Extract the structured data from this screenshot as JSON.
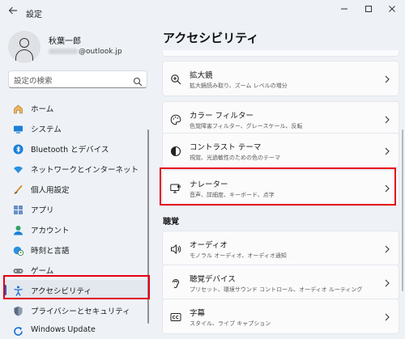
{
  "window": {
    "title": "設定",
    "back_icon": "back-arrow-icon",
    "controls": [
      "minimize-icon",
      "maximize-icon",
      "close-icon"
    ]
  },
  "user": {
    "name": "秋葉一郎",
    "email_visible": "@outlook.jp"
  },
  "search": {
    "placeholder": "設定の検索"
  },
  "sidebar": {
    "items": [
      {
        "label": "ホーム",
        "icon": "home-icon"
      },
      {
        "label": "システム",
        "icon": "system-icon"
      },
      {
        "label": "Bluetooth とデバイス",
        "icon": "bluetooth-icon"
      },
      {
        "label": "ネットワークとインターネット",
        "icon": "wifi-icon"
      },
      {
        "label": "個人用設定",
        "icon": "brush-icon"
      },
      {
        "label": "アプリ",
        "icon": "apps-icon"
      },
      {
        "label": "アカウント",
        "icon": "account-icon"
      },
      {
        "label": "時刻と言語",
        "icon": "globe-clock-icon"
      },
      {
        "label": "ゲーム",
        "icon": "gamepad-icon"
      },
      {
        "label": "アクセシビリティ",
        "icon": "accessibility-icon",
        "selected": true
      },
      {
        "label": "プライバシーとセキュリティ",
        "icon": "shield-icon"
      },
      {
        "label": "Windows Update",
        "icon": "update-icon"
      }
    ]
  },
  "main": {
    "title": "アクセシビリティ",
    "cards": [
      {
        "title": "拡大鏡",
        "subtitle": "拡大鏡読み取り、ズーム レベルの増分",
        "icon": "magnifier-icon"
      },
      {
        "title": "カラー フィルター",
        "subtitle": "色覚障害フィルター、グレースケール、反転",
        "icon": "color-palette-icon"
      },
      {
        "title": "コントラスト テーマ",
        "subtitle": "視覚、光過敏性のための色のテーマ",
        "icon": "contrast-icon"
      },
      {
        "title": "ナレーター",
        "subtitle": "音声、詳細度、キーボード、点字",
        "icon": "narrator-icon",
        "highlighted": true
      }
    ],
    "section_label": "聴覚",
    "hearing_cards": [
      {
        "title": "オーディオ",
        "subtitle": "モノラル オーディオ、オーディオ通知",
        "icon": "speaker-icon"
      },
      {
        "title": "聴覚デバイス",
        "subtitle": "プリセット、環境サウンド コントロール、オーディオ ルーティング",
        "icon": "hearing-icon"
      },
      {
        "title": "字幕",
        "subtitle": "スタイル、ライブ キャプション",
        "icon": "captions-icon"
      }
    ]
  },
  "colors": {
    "accent": "#0067c0",
    "highlight": "#e60012",
    "background": "#eef2f7",
    "card": "#fbfbfc"
  }
}
